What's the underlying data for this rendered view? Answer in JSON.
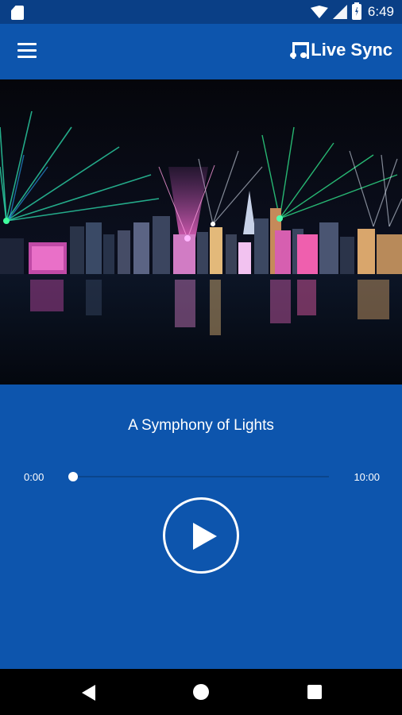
{
  "status_bar": {
    "time": "6:49",
    "icons": [
      "sd-card-icon",
      "wifi-icon",
      "signal-icon",
      "battery-charging-icon"
    ]
  },
  "app_bar": {
    "menu_icon": "hamburger-menu-icon",
    "live_sync_label": "Live Sync",
    "live_sync_icon": "music-note-icon"
  },
  "hero": {
    "description_icon": "city-skyline-light-show"
  },
  "player": {
    "title": "A Symphony of Lights",
    "current_time": "0:00",
    "total_time": "10:00",
    "progress": 0.0,
    "play_icon": "play-icon"
  },
  "nav_bar": {
    "icons": [
      "back-icon",
      "home-icon",
      "recents-icon"
    ]
  },
  "colors": {
    "primary": "#0d55ad",
    "status_bar": "#0a3f86",
    "nav_bar": "#000000"
  }
}
